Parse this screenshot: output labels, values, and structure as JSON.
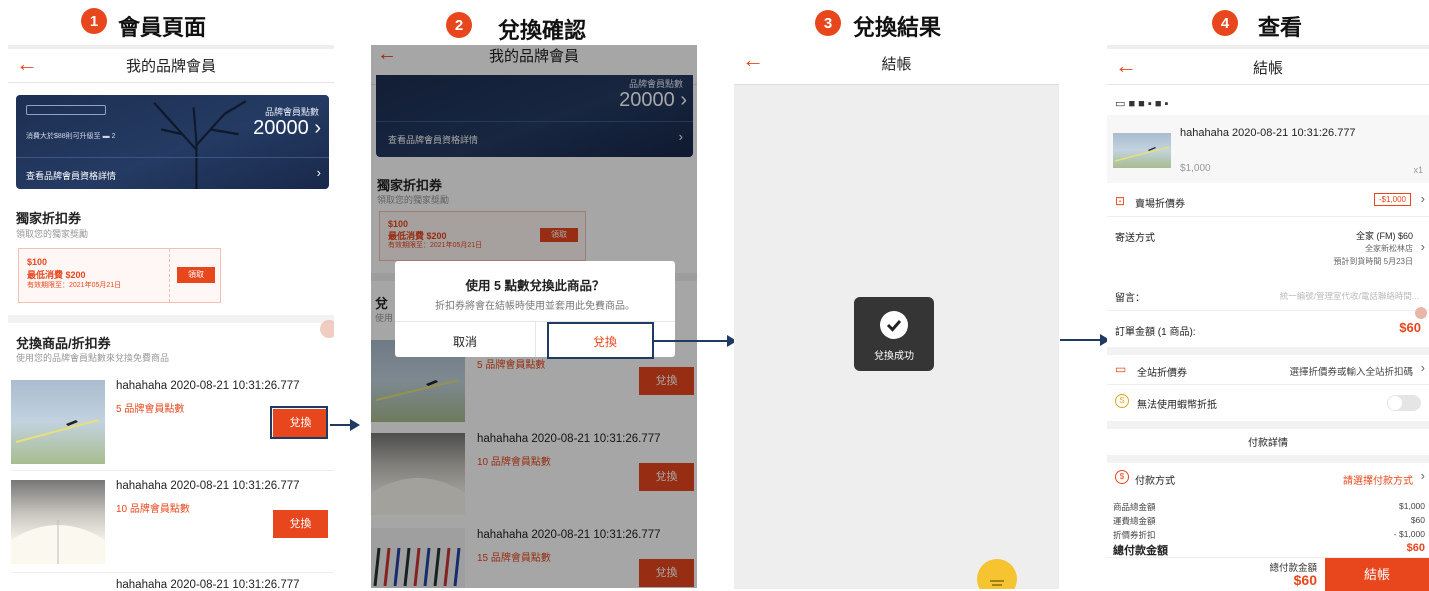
{
  "steps": [
    {
      "num": "1",
      "title": "會員頁面"
    },
    {
      "num": "2",
      "title": "兌換確認"
    },
    {
      "num": "3",
      "title": "兌換結果"
    },
    {
      "num": "4",
      "title": "查看"
    }
  ],
  "screen1": {
    "nav_title": "我的品牌會員",
    "card": {
      "points_label": "品牌會員點數",
      "points_value": "20000",
      "spend_note": "消費大於$88則可升級至",
      "level": "2",
      "details_link": "查看品牌會員資格詳情"
    },
    "exclusive": {
      "title": "獨家折扣券",
      "subtitle": "領取您的獨家獎勵",
      "coupon_amount": "$100",
      "coupon_min": "最低消費 $200",
      "coupon_valid": "有效期限至：2021年05月21日",
      "claim_label": "領取"
    },
    "redeem": {
      "title": "兌換商品/折扣券",
      "subtitle": "使用您的品牌會員點數來兌換免費商品",
      "items": [
        {
          "title": "hahahaha 2020-08-21 10:31:26.777",
          "points": "5 品牌會員點數",
          "btn": "兌換"
        },
        {
          "title": "hahahaha 2020-08-21 10:31:26.777",
          "points": "10 品牌會員點數",
          "btn": "兌換"
        },
        {
          "title": "hahahaha 2020-08-21 10:31:26.777"
        }
      ]
    }
  },
  "screen2": {
    "nav_title": "我的品牌會員",
    "card": {
      "points_label": "品牌會員點數",
      "points_value": "20000",
      "details_link": "查看品牌會員資格詳情"
    },
    "exclusive": {
      "title": "獨家折扣券",
      "subtitle": "領取您的獨家獎勵",
      "coupon_amount": "$100",
      "coupon_min": "最低消費 $200",
      "coupon_valid": "有效期限至：2021年05月21日",
      "claim_label": "領取"
    },
    "redeem_partial": "兌",
    "redeem_sub_partial": "使用",
    "dialog": {
      "title": "使用 5 點數兌換此商品？",
      "message": "折扣券將會在結帳時使用並套用此免費商品。",
      "cancel": "取消",
      "confirm": "兌換"
    },
    "items": [
      {
        "points": "5 品牌會員點數",
        "btn": "兌換"
      },
      {
        "title": "hahahaha 2020-08-21 10:31:26.777",
        "points": "10 品牌會員點數",
        "btn": "兌換"
      },
      {
        "title": "hahahaha 2020-08-21 10:31:26.777",
        "points": "15 品牌會員點數",
        "btn": "兌換"
      }
    ]
  },
  "screen3": {
    "nav_title": "結帳",
    "toast": "兌換成功"
  },
  "screen4": {
    "nav_title": "結帳",
    "product": {
      "title": "hahahaha 2020-08-21 10:31:26.777",
      "price": "$1,000",
      "qty": "x1"
    },
    "shop_voucher": {
      "label": "賣場折價券",
      "value": "-$1,000"
    },
    "shipping": {
      "label": "寄送方式",
      "method": "全家 (FM) $60",
      "store": "全家新松林店",
      "eta": "預計到貨時間 5月23日"
    },
    "message": {
      "label": "留言：",
      "placeholder": "統一編號/管理室代收/電話聯絡時間..."
    },
    "order_total": {
      "label": "訂單金額 (1 商品):",
      "value": "$60"
    },
    "site_voucher": {
      "label": "全站折價券",
      "value": "選擇折價券或輸入全站折扣碼"
    },
    "coins": {
      "label": "無法使用蝦幣折抵"
    },
    "payment_details_title": "付款詳情",
    "payment_method": {
      "label": "付款方式",
      "value": "請選擇付款方式"
    },
    "summary": [
      {
        "label": "商品總金額",
        "value": "$1,000"
      },
      {
        "label": "運費總金額",
        "value": "$60"
      },
      {
        "label": "折價券折扣",
        "value": "- $1,000"
      }
    ],
    "grand_total": {
      "label": "總付款金額",
      "value": "$60"
    },
    "footer": {
      "total_label": "總付款金額",
      "total_value": "$60",
      "checkout": "結帳"
    }
  },
  "colors": {
    "accent": "#e8471e",
    "navy": "#1f3a63",
    "card": "#1d2f52"
  }
}
